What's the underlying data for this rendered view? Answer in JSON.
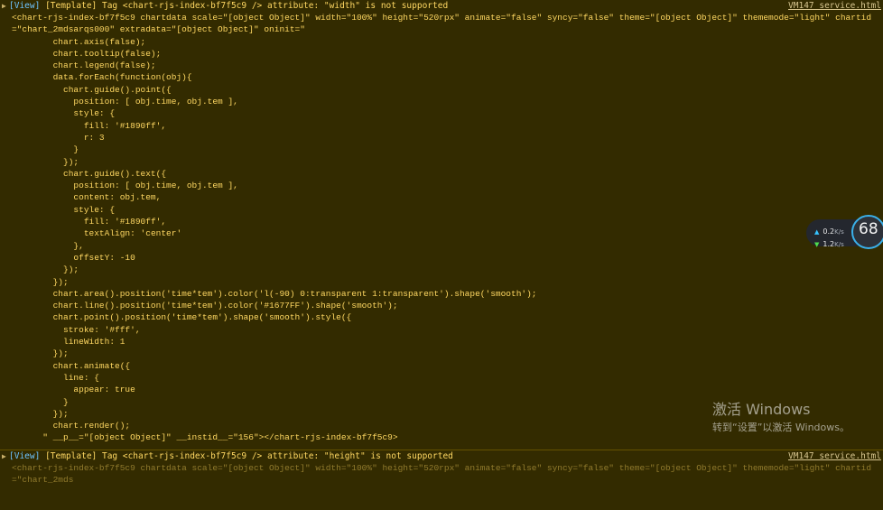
{
  "colors": {
    "background": "#332b00",
    "warning_text": "#ffd862",
    "view_tag": "#6ec4ff",
    "gauge_ring": "#3ab0ea"
  },
  "entries": [
    {
      "caret": "▶",
      "view_tag": "[View]",
      "message": "[Template] Tag <chart-rjs-index-bf7f5c9 /> attribute: \"width\" is not supported",
      "source": "VM147 service.html",
      "code": "<chart-rjs-index-bf7f5c9 chartdata scale=\"[object Object]\" width=\"100%\" height=\"520rpx\" animate=\"false\" syncy=\"false\" theme=\"[object Object]\" thememode=\"light\" chartid=\"chart_2mdsarqs000\" extradata=\"[object Object]\" oninit=\"\n        chart.axis(false);\n        chart.tooltip(false);\n        chart.legend(false);\n        data.forEach(function(obj){\n          chart.guide().point({\n            position: [ obj.time, obj.tem ],\n            style: {\n              fill: '#1890ff',\n              r: 3\n            }\n          });\n          chart.guide().text({\n            position: [ obj.time, obj.tem ],\n            content: obj.tem,\n            style: {\n              fill: '#1890ff',\n              textAlign: 'center'\n            },\n            offsetY: -10\n          });\n        });\n        chart.area().position('time*tem').color('l(-90) 0:transparent 1:transparent').shape('smooth');\n        chart.line().position('time*tem').color('#1677FF').shape('smooth');\n        chart.point().position('time*tem').shape('smooth').style({\n          stroke: '#fff',\n          lineWidth: 1\n        });\n        chart.animate({\n          line: {\n            appear: true\n          }\n        });\n        chart.render();\n      \" __p__=\"[object Object]\" __instid__=\"156\"></chart-rjs-index-bf7f5c9>"
    },
    {
      "caret": "▶",
      "view_tag": "[View]",
      "message": "[Template] Tag <chart-rjs-index-bf7f5c9 /> attribute: \"height\" is not supported",
      "source": "VM147 service.html",
      "code": "<chart-rjs-index-bf7f5c9 chartdata scale=\"[object Object]\" width=\"100%\" height=\"520rpx\" animate=\"false\" syncy=\"false\" theme=\"[object Object]\" thememode=\"light\" chartid=\"chart_2mds"
    }
  ],
  "speed_widget": {
    "upload_value": "0.2",
    "upload_unit": "K/s",
    "download_value": "1.2",
    "download_unit": "K/s",
    "gauge_value": "68",
    "up_icon": "arrow-up-icon",
    "down_icon": "arrow-down-icon"
  },
  "watermark": {
    "title": "激活 Windows",
    "subtitle": "转到“设置”以激活 Windows。"
  }
}
